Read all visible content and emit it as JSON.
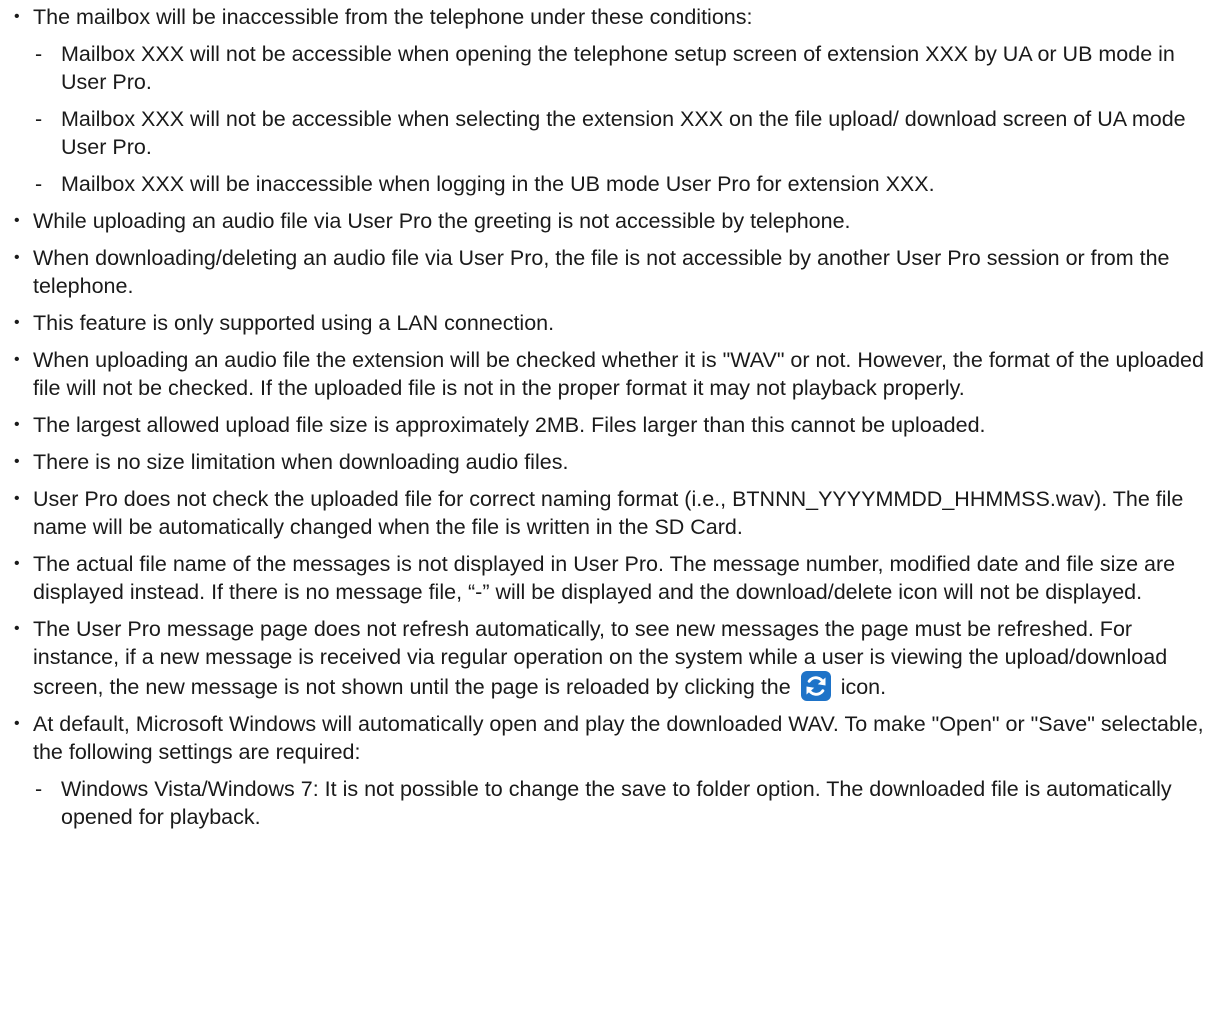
{
  "bullets": {
    "mailbox_intro": "The mailbox will be inaccessible from the telephone under these conditions:",
    "mailbox_conditions": [
      "Mailbox XXX will not be accessible when opening the telephone setup screen of extension XXX by UA or UB mode in User Pro.",
      "Mailbox XXX will not be accessible when selecting the extension XXX on the file upload/ download screen of UA mode User Pro.",
      "Mailbox XXX will be inaccessible when logging in the UB mode User Pro for extension XXX."
    ],
    "uploading_greeting": "While uploading an audio file via User Pro the greeting is not accessible by telephone.",
    "downloading_deleting": "When downloading/deleting an audio file via User Pro, the file is not accessible by another User Pro session or from the telephone.",
    "lan_only": "This feature is only supported using a LAN connection.",
    "wav_check": "When uploading an audio file the extension will be checked whether it is \"WAV\" or not. However, the format of the uploaded file will not be checked. If the uploaded file is not in the proper format it may not playback properly.",
    "max_upload": "The largest allowed upload file size is approximately 2MB. Files larger than this cannot be uploaded.",
    "no_download_limit": "There is no size limitation when downloading audio files.",
    "naming_format": "User Pro does not check the uploaded file for correct naming format (i.e., BTNNN_YYYYMMDD_HHMMSS.wav). The file name will be automatically changed when the file is written in the SD Card.",
    "file_name_display": "The actual file name of the messages is not displayed in User Pro. The message number, modified date and file size are displayed instead. If there is no message file, “-” will be displayed and the download/delete icon will not be displayed.",
    "refresh_before": "The User Pro message page does not refresh automatically, to see new messages the page must be refreshed. For instance, if a new message is received via regular operation on the system while a user is viewing the upload/download screen, the new message is not shown until the page is reloaded by clicking the",
    "refresh_after": "icon.",
    "windows_default": "At default, Microsoft Windows will automatically open and play the downloaded WAV. To make \"Open\" or \"Save\" selectable, the following settings are required:",
    "windows_settings": [
      "Windows Vista/Windows 7: It is not possible to change the save to folder option. The downloaded file is automatically opened for playback."
    ]
  },
  "symbols": {
    "bullet": "•",
    "dash": "-"
  },
  "icons": {
    "refresh": "refresh-icon"
  },
  "colors": {
    "text": "#1a1a1a",
    "refresh_icon_bg": "#1e73c8",
    "refresh_icon_fg": "#ffffff"
  }
}
